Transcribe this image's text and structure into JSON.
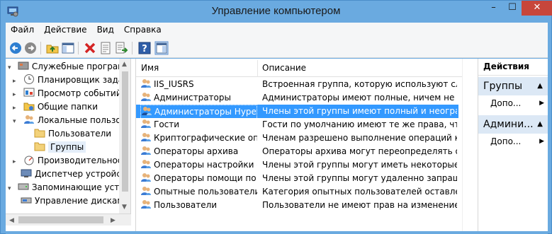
{
  "window": {
    "title": "Управление компьютером",
    "minimize_label": "–",
    "maximize_label": "☐",
    "close_label": "✕"
  },
  "menu": [
    "Файл",
    "Действие",
    "Вид",
    "Справка"
  ],
  "toolbar": {
    "icons": [
      "back-icon",
      "forward-icon",
      "up-folder-icon",
      "show-hide-tree-icon",
      "delete-icon",
      "properties-icon",
      "export-list-icon",
      "help-icon",
      "show-hide-action-pane-icon"
    ]
  },
  "tree": {
    "items": [
      {
        "label": "Служебные программы",
        "level": 0,
        "expand": "▾"
      },
      {
        "label": "Планировщик задани",
        "level": 1,
        "expand": "▸"
      },
      {
        "label": "Просмотр событий",
        "level": 1,
        "expand": "▸"
      },
      {
        "label": "Общие папки",
        "level": 1,
        "expand": "▸"
      },
      {
        "label": "Локальные пользовате",
        "level": 1,
        "expand": "▾"
      },
      {
        "label": "Пользователи",
        "level": 2,
        "expand": ""
      },
      {
        "label": "Группы",
        "level": 2,
        "expand": ""
      },
      {
        "label": "Производительность",
        "level": 1,
        "expand": "▸"
      },
      {
        "label": "Диспетчер устройств",
        "level": 1,
        "expand": ""
      },
      {
        "label": "Запоминающие устройст",
        "level": 0,
        "expand": "▾"
      },
      {
        "label": "Управление дисками",
        "level": 1,
        "expand": ""
      }
    ]
  },
  "list": {
    "col_name": "Имя",
    "col_desc": "Описание",
    "rows": [
      {
        "name": "IIS_IUSRS",
        "desc": "Встроенная группа, которую используют служ..."
      },
      {
        "name": "Администраторы",
        "desc": "Администраторы имеют полные, ничем не огр..."
      },
      {
        "name": "Администраторы Hyper-V",
        "desc": "Члены этой группы имеют полный и неограни..."
      },
      {
        "name": "Гости",
        "desc": "Гости по умолчанию имеют те же права, что и ..."
      },
      {
        "name": "Криптографические опе...",
        "desc": "Членам разрешено выполнение операций кри..."
      },
      {
        "name": "Операторы архива",
        "desc": "Операторы архива могут переопределять огра..."
      },
      {
        "name": "Операторы настройки с...",
        "desc": "Члены этой группы могут иметь некоторые ад..."
      },
      {
        "name": "Операторы помощи по ...",
        "desc": "Члены этой группы могут удаленно запрашив..."
      },
      {
        "name": "Опытные пользователи",
        "desc": "Категория опытных пользователей оставлена ..."
      },
      {
        "name": "Пользователи",
        "desc": "Пользователи не имеют прав на изменение ра..."
      }
    ]
  },
  "actions": {
    "header": "Действия",
    "section1": "Группы",
    "item1": "Допо...",
    "section2": "Админи...",
    "item2": "Допо..."
  },
  "colors": {
    "title_bar": "#6aaae0",
    "selection": "#3399ff",
    "close_button": "#c7463b"
  }
}
